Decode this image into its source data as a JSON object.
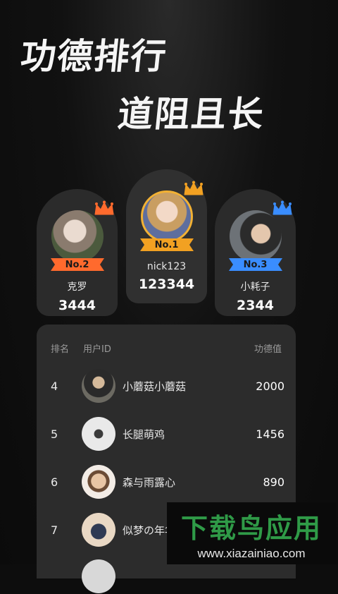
{
  "hero": {
    "line1": "功德排行",
    "line2": "道阻且长"
  },
  "podium": {
    "first": {
      "rank": "No.1",
      "name": "nick123",
      "score": "123344",
      "color": "#f2a122"
    },
    "second": {
      "rank": "No.2",
      "name": "克罗",
      "score": "3444",
      "color": "#ff6a2d"
    },
    "third": {
      "rank": "No.3",
      "name": "小耗子",
      "score": "2344",
      "color": "#3a8dff"
    }
  },
  "table": {
    "headers": {
      "rank": "排名",
      "user": "用户ID",
      "score": "功德值"
    },
    "rows": [
      {
        "rank": "4",
        "name": "小蘑菇小蘑菇",
        "score": "2000"
      },
      {
        "rank": "5",
        "name": "长腿萌鸡",
        "score": "1456"
      },
      {
        "rank": "6",
        "name": "森与雨露心",
        "score": "890"
      },
      {
        "rank": "7",
        "name": "似梦の年华",
        "score": ""
      }
    ]
  },
  "watermark": {
    "title": "下载鸟应用",
    "url": "www.xiazainiao.com"
  }
}
